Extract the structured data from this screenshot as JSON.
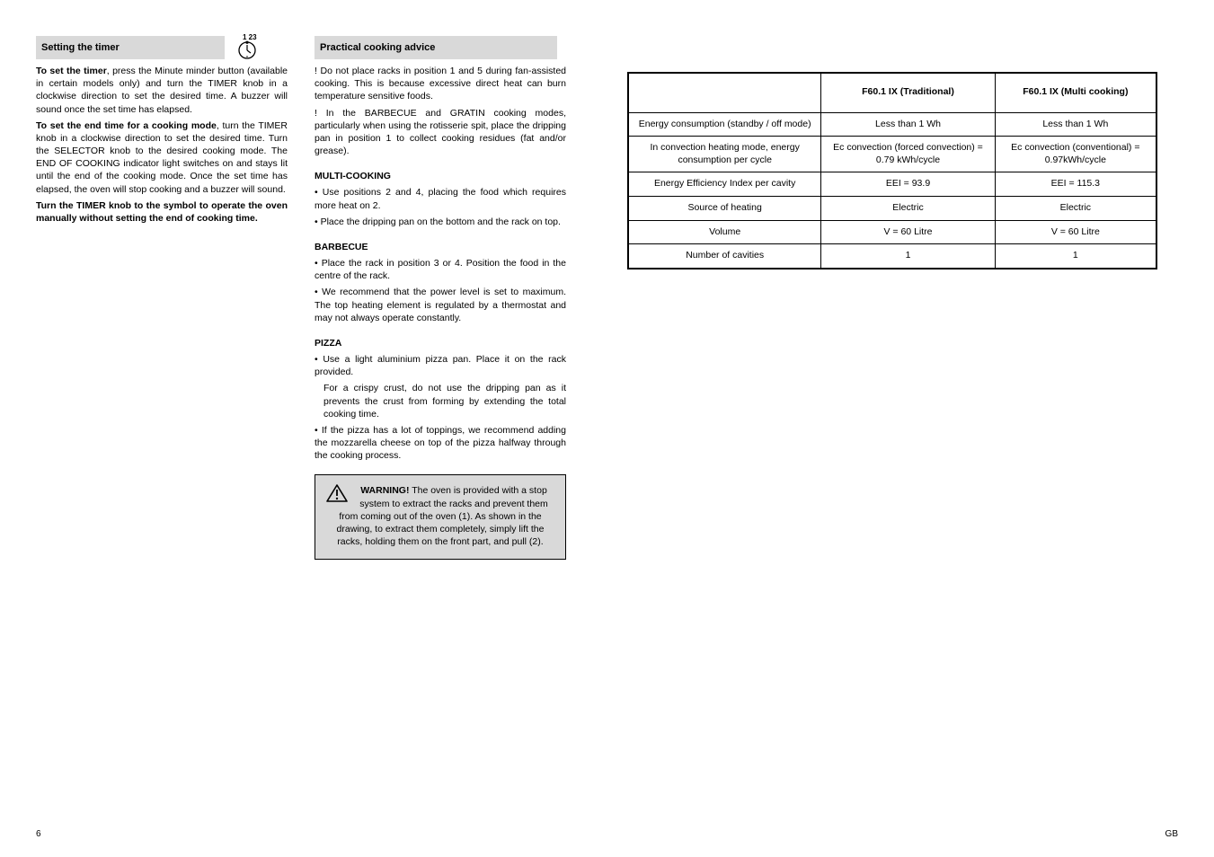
{
  "clock_label": "1 23",
  "col1": {
    "heading": "Setting the timer",
    "bold_a": "To set the timer",
    "p1a": ", press the Minute minder button (available in certain models only) and turn the TIMER knob in a clockwise direction to set the desired time. A buzzer will sound once the set time has elapsed.",
    "bold_b": "To set the end time for a cooking mode",
    "p1b": ", turn the TIMER knob in a clockwise direction to set the desired time. Turn the SELECTOR knob to the desired cooking mode. The END OF COOKING indicator light switches on and stays lit until the end of the cooking mode. Once the set time has elapsed, the oven will stop cooking and a buzzer will sound.",
    "note": "Turn the TIMER knob to the     symbol to operate the oven manually without setting the end of cooking time."
  },
  "col2": {
    "heading": "Practical cooking advice",
    "p1": "! Do not place racks in position 1 and 5 during fan-assisted cooking. This is because excessive direct heat can burn temperature sensitive foods.",
    "p2": "! In the BARBECUE and GRATIN cooking modes, particularly when using the rotisserie spit, place the dripping pan in position 1 to collect cooking residues (fat and/or grease).",
    "sub1": "MULTI-COOKING",
    "b1": "• Use positions 2 and 4, placing the food which requires more heat on 2.",
    "b2": "• Place the dripping pan on the bottom and the rack on top.",
    "sub2": "BARBECUE",
    "b3": "• Place the rack in position 3 or 4. Position the food in the centre of the rack.",
    "b4": "• We recommend that the power level is set to maximum. The top heating element is regulated by a thermostat and may not always operate constantly.",
    "sub3": "PIZZA",
    "b5": "• Use a light aluminium pizza pan. Place it on the rack provided.",
    "b6": "  For a crispy crust, do not use the dripping pan as it prevents the crust from forming by extending the total cooking time.",
    "b7": "• If the pizza has a lot of toppings, we recommend adding the mozzarella cheese on top of the pizza halfway through the cooking process.",
    "warn_lead": "WARNING!",
    "warn_rest": " The oven is provided with a stop system to extract the racks and prevent them from coming out of the oven (1). As shown in the drawing, to extract them completely, simply lift the racks, holding them on the front part, and pull (2)."
  },
  "table": {
    "headers": [
      "",
      "F60.1 IX (Traditional)",
      "F60.1 IX (Multi cooking)"
    ],
    "rows": [
      [
        "Energy consumption (standby / off mode)",
        "Less than 1 Wh",
        "Less than 1 Wh"
      ],
      [
        "In convection heating mode, energy consumption per cycle",
        "Ec convection (forced convection) = 0.79 kWh/cycle",
        "Ec convection (conventional) = 0.97kWh/cycle"
      ],
      [
        "Energy Efficiency Index per cavity",
        "EEI = 93.9",
        "EEI = 115.3"
      ],
      [
        "Source of heating",
        "Electric",
        "Electric"
      ],
      [
        "Volume",
        "V = 60 Litre",
        "V = 60 Litre"
      ],
      [
        "Number of cavities",
        "1",
        "1"
      ]
    ]
  },
  "footer": {
    "left": "6",
    "right": "GB"
  }
}
